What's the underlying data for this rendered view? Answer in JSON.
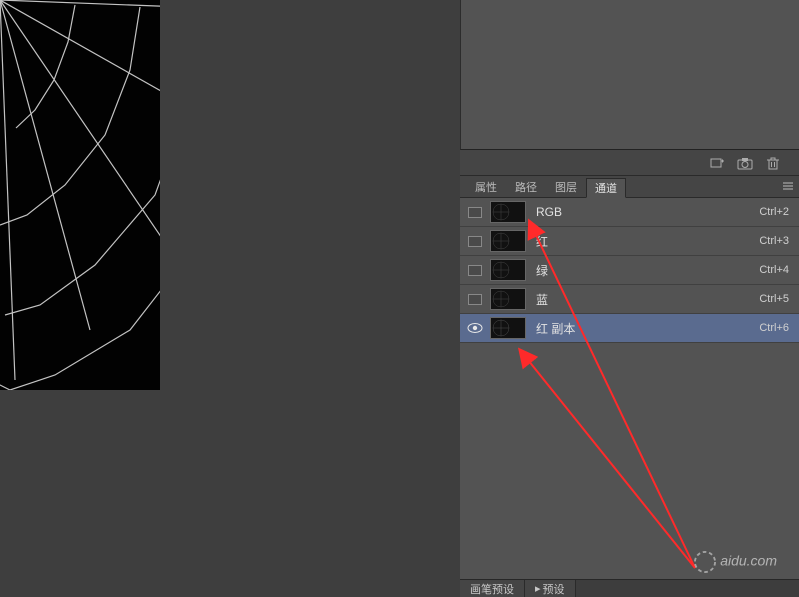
{
  "tabs": {
    "properties": "属性",
    "paths": "路径",
    "layers": "图层",
    "channels": "通道"
  },
  "channels": [
    {
      "name": "RGB",
      "shortcut": "Ctrl+2",
      "visible": false,
      "selected": false
    },
    {
      "name": "红",
      "shortcut": "Ctrl+3",
      "visible": false,
      "selected": false
    },
    {
      "name": "绿",
      "shortcut": "Ctrl+4",
      "visible": false,
      "selected": false
    },
    {
      "name": "蓝",
      "shortcut": "Ctrl+5",
      "visible": false,
      "selected": false
    },
    {
      "name": "红 副本",
      "shortcut": "Ctrl+6",
      "visible": true,
      "selected": true
    }
  ],
  "bottom_bar": {
    "brush_presets": "画笔预设",
    "presets": "预设"
  },
  "watermark": "aidu.com"
}
